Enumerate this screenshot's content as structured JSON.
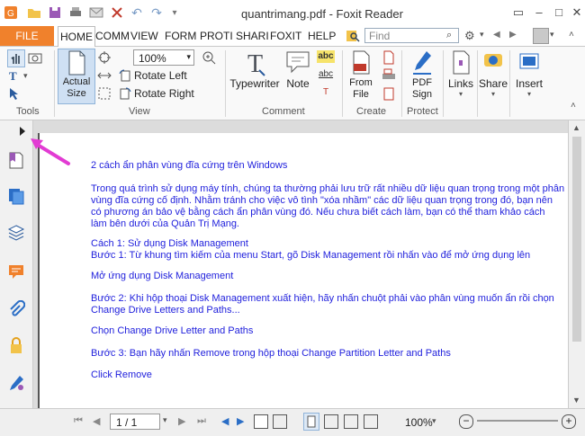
{
  "window": {
    "title": "quantrimang.pdf - Foxit Reader"
  },
  "menu": {
    "file": "FILE",
    "tabs": [
      "HOME",
      "COMM",
      "VIEW",
      "FORM",
      "PROTI",
      "SHARI",
      "FOXIT",
      "HELP"
    ],
    "find_placeholder": "Find"
  },
  "ribbon": {
    "tools_label": "Tools",
    "view_label": "View",
    "comment_label": "Comment",
    "create_label": "Create",
    "protect_label": "Protect",
    "actual_size": "Actual Size",
    "zoom": "100%",
    "rotate_left": "Rotate Left",
    "rotate_right": "Rotate Right",
    "typewriter": "Typewriter",
    "note": "Note",
    "from_file": "From File",
    "pdf_sign": "PDF Sign",
    "links": "Links",
    "share": "Share",
    "insert": "Insert"
  },
  "document": {
    "lines": [
      "2 cách ẩn phân vùng đĩa cứng trên Windows",
      "Trong quá trình sử dụng máy tính, chúng ta thường phải lưu trữ rất nhiều dữ liệu quan trọng trong một phân",
      "vùng đĩa cứng cố định. Nhằm tránh cho việc vô tình \"xóa nhầm\" các dữ liệu quan trọng trong đó, bạn nên",
      "có phương án bảo vệ bằng cách ẩn phân vùng đó. Nếu chưa biết cách làm, bạn có thể tham khảo cách",
      "làm bên dưới của Quản Trị Mạng.",
      "Cách 1: Sử dụng Disk Management",
      "Bước 1: Từ khung tìm kiếm của menu Start, gõ Disk Management rồi nhấn vào để mở ứng dụng lên",
      "Mở ứng dụng Disk Management",
      "Bước 2: Khi hộp thoại Disk Management xuất hiện, hãy nhấn chuột phải vào phân vùng muốn ẩn rồi chọn",
      "Change Drive Letters and Paths...",
      "Chọn Change Drive Letter and Paths",
      "Bước 3: Bạn hãy nhấn Remove trong hộp thoại Change Partition Letter and Paths",
      "Click Remove"
    ]
  },
  "status": {
    "page": "1 / 1",
    "zoom": "100%"
  },
  "colors": {
    "file_tab": "#f0812c",
    "doc_text": "#1e1edc",
    "arrow": "#e23bd3"
  }
}
